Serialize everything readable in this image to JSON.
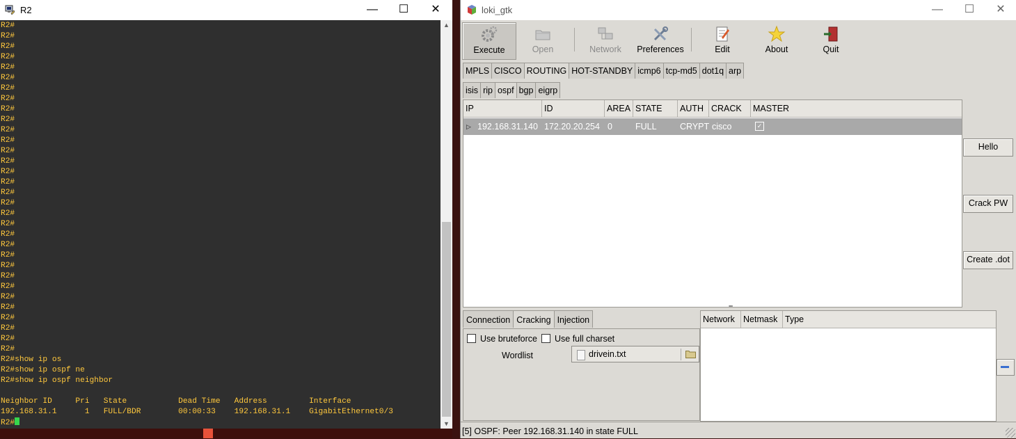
{
  "terminal": {
    "title": "R2",
    "window_controls": {
      "minimize": "—",
      "maximize": "☐",
      "close": "✕"
    },
    "prompt_lines": [
      "R2#",
      "R2#",
      "R2#",
      "R2#",
      "R2#",
      "R2#",
      "R2#",
      "R2#",
      "R2#",
      "R2#",
      "R2#",
      "R2#",
      "R2#",
      "R2#",
      "R2#",
      "R2#",
      "R2#",
      "R2#",
      "R2#",
      "R2#",
      "R2#",
      "R2#",
      "R2#",
      "R2#",
      "R2#",
      "R2#",
      "R2#",
      "R2#",
      "R2#",
      "R2#",
      "R2#",
      "R2#"
    ],
    "commands": [
      "R2#show ip os",
      "R2#show ip ospf ne",
      "R2#show ip ospf neighbor"
    ],
    "neighbor_header": "Neighbor ID     Pri   State           Dead Time   Address         Interface",
    "neighbor_row": "192.168.31.1      1   FULL/BDR        00:00:33    192.168.31.1    GigabitEthernet0/3",
    "final_prompt": "R2#"
  },
  "loki": {
    "title": "loki_gtk",
    "window_controls": {
      "minimize": "—",
      "maximize": "☐",
      "close": "✕"
    },
    "toolbar": {
      "execute": "Execute",
      "open": "Open",
      "network": "Network",
      "preferences": "Preferences",
      "edit": "Edit",
      "about": "About",
      "quit": "Quit"
    },
    "protocol_tabs": [
      "MPLS",
      "CISCO",
      "ROUTING",
      "HOT-STANDBY",
      "icmp6",
      "tcp-md5",
      "dot1q",
      "arp"
    ],
    "active_protocol_tab": "ROUTING",
    "routing_tabs": [
      "isis",
      "rip",
      "ospf",
      "bgp",
      "eigrp"
    ],
    "active_routing_tab": "ospf",
    "columns": [
      "IP",
      "ID",
      "AREA",
      "STATE",
      "AUTH",
      "CRACK",
      "MASTER"
    ],
    "rows": [
      {
        "ip": "192.168.31.140",
        "id": "172.20.20.254",
        "area": "0",
        "state": "FULL",
        "auth": "CRYPT",
        "crack": "cisco",
        "master": true
      }
    ],
    "side_buttons": {
      "hello": "Hello",
      "crack_pw": "Crack PW",
      "create_dot": "Create .dot"
    },
    "bottom_tabs": [
      "Connection",
      "Cracking",
      "Injection"
    ],
    "active_bottom_tab": "Cracking",
    "cracking": {
      "use_bruteforce": "Use bruteforce",
      "use_full_charset": "Use full charset",
      "wordlist_label": "Wordlist",
      "wordlist_file": "drivein.txt"
    },
    "net_columns": [
      "Network",
      "Netmask",
      "Type"
    ],
    "status": "[5] OSPF: Peer 192.168.31.140 in state FULL"
  }
}
